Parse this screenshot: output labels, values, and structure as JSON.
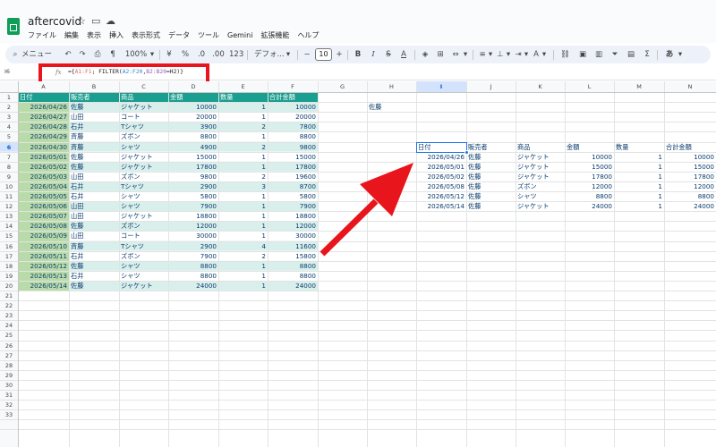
{
  "app": {
    "doc_title": "aftercovid"
  },
  "menu": [
    "ファイル",
    "編集",
    "表示",
    "挿入",
    "表示形式",
    "データ",
    "ツール",
    "Gemini",
    "拡張機能",
    "ヘルプ"
  ],
  "toolbar": {
    "search_label": "メニュー",
    "zoom": "100%",
    "percent": "%",
    "decimal_less": ".0",
    "decimal_more": ".00",
    "number_format": "123",
    "font_name": "デフォ...",
    "font_size": "10",
    "bold": "B",
    "italic": "I",
    "strikethrough": "S",
    "text_color": "A",
    "input_tools": "あ"
  },
  "formula_bar": {
    "cell_ref": "I6",
    "fx": "fx",
    "parts": [
      "={",
      "A1:F1",
      "; FILTER(",
      "A2:F20",
      ",",
      "B2:B20",
      "=H2)}"
    ]
  },
  "colors": {
    "header_fill": "#1a9e8f",
    "band_light": "#d9efec",
    "band_date": "#b9dbaa",
    "data_text": "#0b3d6e",
    "highlight": "#e8151c",
    "selection": "#1a73e8"
  },
  "columns": [
    "A",
    "B",
    "C",
    "D",
    "E",
    "F",
    "G",
    "H",
    "I",
    "J",
    "K",
    "L",
    "M",
    "N"
  ],
  "row_count": 33,
  "source_table": {
    "headers": [
      "日付",
      "販売者",
      "商品",
      "金額",
      "数量",
      "合計金額"
    ],
    "rows": [
      [
        "2026/04/26",
        "佐藤",
        "ジャケット",
        "10000",
        "1",
        "10000"
      ],
      [
        "2026/04/27",
        "山田",
        "コート",
        "20000",
        "1",
        "20000"
      ],
      [
        "2026/04/28",
        "石井",
        "Tシャツ",
        "3900",
        "2",
        "7800"
      ],
      [
        "2026/04/29",
        "斉藤",
        "ズボン",
        "8800",
        "1",
        "8800"
      ],
      [
        "2026/04/30",
        "斉藤",
        "シャツ",
        "4900",
        "2",
        "9800"
      ],
      [
        "2026/05/01",
        "佐藤",
        "ジャケット",
        "15000",
        "1",
        "15000"
      ],
      [
        "2026/05/02",
        "佐藤",
        "ジャケット",
        "17800",
        "1",
        "17800"
      ],
      [
        "2026/05/03",
        "山田",
        "ズボン",
        "9800",
        "2",
        "19600"
      ],
      [
        "2026/05/04",
        "石井",
        "Tシャツ",
        "2900",
        "3",
        "8700"
      ],
      [
        "2026/05/05",
        "石井",
        "シャツ",
        "5800",
        "1",
        "5800"
      ],
      [
        "2026/05/06",
        "山田",
        "シャツ",
        "7900",
        "1",
        "7900"
      ],
      [
        "2026/05/07",
        "山田",
        "ジャケット",
        "18800",
        "1",
        "18800"
      ],
      [
        "2026/05/08",
        "佐藤",
        "ズボン",
        "12000",
        "1",
        "12000"
      ],
      [
        "2026/05/09",
        "山田",
        "コート",
        "30000",
        "1",
        "30000"
      ],
      [
        "2026/05/10",
        "斉藤",
        "Tシャツ",
        "2900",
        "4",
        "11600"
      ],
      [
        "2026/05/11",
        "石井",
        "ズボン",
        "7900",
        "2",
        "15800"
      ],
      [
        "2026/05/12",
        "佐藤",
        "シャツ",
        "8800",
        "1",
        "8800"
      ],
      [
        "2026/05/13",
        "石井",
        "シャツ",
        "8800",
        "1",
        "8800"
      ],
      [
        "2026/05/14",
        "佐藤",
        "ジャケット",
        "24000",
        "1",
        "24000"
      ]
    ]
  },
  "criteria_cell": "佐藤",
  "result_table": {
    "headers": [
      "日付",
      "販売者",
      "商品",
      "金額",
      "数量",
      "合計金額"
    ],
    "rows": [
      [
        "2026/04/26",
        "佐藤",
        "ジャケット",
        "10000",
        "1",
        "10000"
      ],
      [
        "2026/05/01",
        "佐藤",
        "ジャケット",
        "15000",
        "1",
        "15000"
      ],
      [
        "2026/05/02",
        "佐藤",
        "ジャケット",
        "17800",
        "1",
        "17800"
      ],
      [
        "2026/05/08",
        "佐藤",
        "ズボン",
        "12000",
        "1",
        "12000"
      ],
      [
        "2026/05/12",
        "佐藤",
        "シャツ",
        "8800",
        "1",
        "8800"
      ],
      [
        "2026/05/14",
        "佐藤",
        "ジャケット",
        "24000",
        "1",
        "24000"
      ]
    ]
  }
}
